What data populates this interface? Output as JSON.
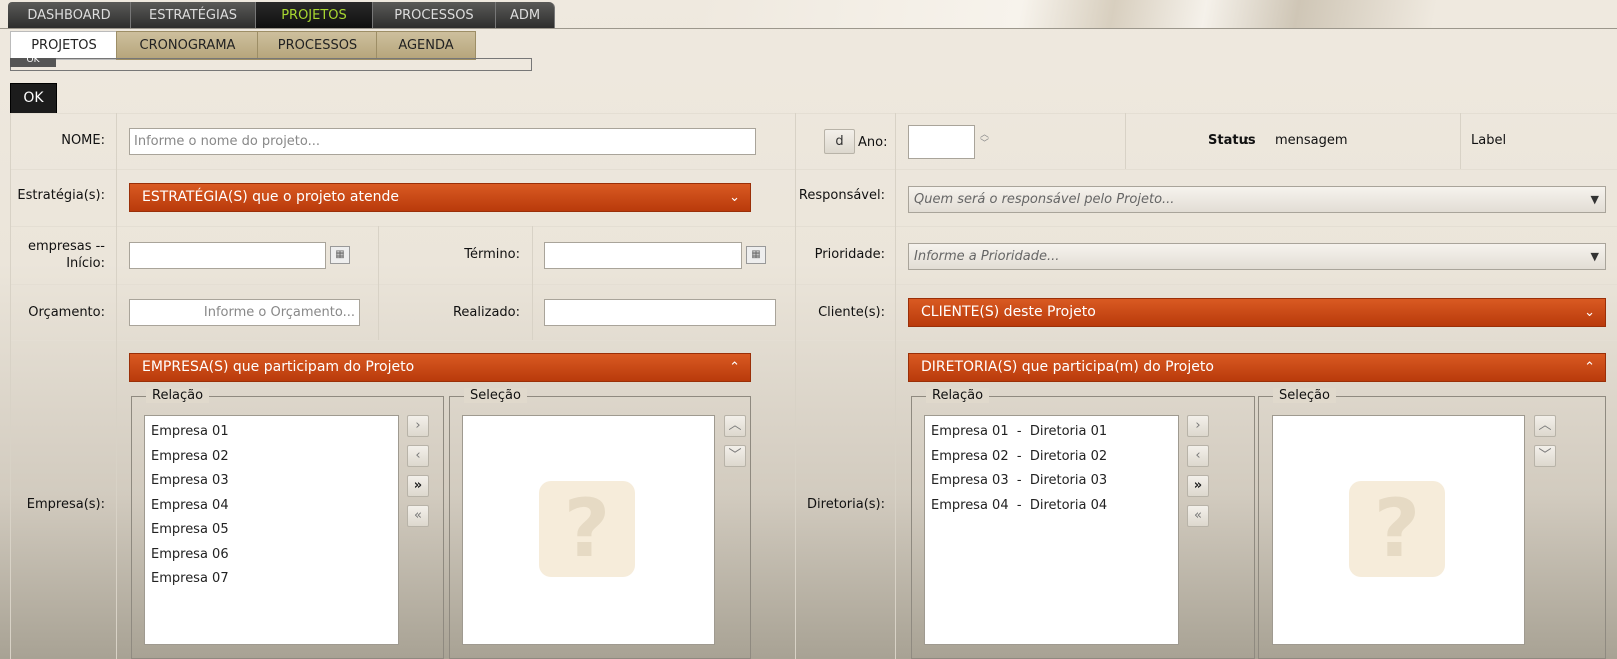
{
  "top_tabs": [
    {
      "label": "DASHBOARD"
    },
    {
      "label": "ESTRATÉGIAS"
    },
    {
      "label": "PROJETOS",
      "active": true
    },
    {
      "label": "PROCESSOS"
    },
    {
      "label": "ADM"
    }
  ],
  "sub_tabs": [
    {
      "label": "PROJETOS",
      "active": true
    },
    {
      "label": "CRONOGRAMA"
    },
    {
      "label": "PROCESSOS"
    },
    {
      "label": "AGENDA"
    }
  ],
  "ok_mini": "OK",
  "ok_button": "OK",
  "form": {
    "nome_label": "NOME:",
    "nome_placeholder": "Informe o nome do projeto...",
    "d_button": "d",
    "ano_label": "Ano:",
    "ano_value": "",
    "status_label": "Status",
    "status_colon": ":",
    "mensagem": "mensagem",
    "label_text": "Label",
    "estrategia_label": "Estratégia(s):",
    "estrategia_dropdown": "ESTRATÉGIA(S) que o projeto atende",
    "responsavel_label": "Responsável:",
    "responsavel_placeholder": "Quem será o responsável pelo Projeto...",
    "inicio_label_1": "empresas  --",
    "inicio_label_2": "Início:",
    "termino_label": "Término:",
    "prioridade_label": "Prioridade:",
    "prioridade_placeholder": "Informe a Prioridade...",
    "orcamento_label": "Orçamento:",
    "orcamento_placeholder": "Informe o Orçamento...",
    "realizado_label": "Realizado:",
    "cliente_label": "Cliente(s):",
    "cliente_dropdown": "CLIENTE(S) deste Projeto",
    "empresas_label": "Empresa(s):",
    "empresas_header": "EMPRESA(S) que participam do Projeto",
    "diretorias_label": "Diretoria(s):",
    "diretorias_header": "DIRETORIA(S) que participa(m) do Projeto",
    "relacao": "Relação",
    "selecao": "Seleção"
  },
  "empresas_list": [
    "Empresa 01",
    "Empresa 02",
    "Empresa 03",
    "Empresa 04",
    "Empresa 05",
    "Empresa 06",
    "Empresa 07"
  ],
  "diretorias_list": [
    "Empresa 01  -  Diretoria 01",
    "Empresa 02  -  Diretoria 02",
    "Empresa 03  -  Diretoria 03",
    "Empresa 04  -  Diretoria 04"
  ],
  "icons": {
    "move_right": "chevron-right-icon",
    "move_left": "chevron-left-icon",
    "move_all_right": "double-chevron-right-icon",
    "move_all_left": "double-chevron-left-icon",
    "up": "chevron-up-icon",
    "down": "chevron-down-icon",
    "calendar": "calendar-icon",
    "help": "question-mark-icon"
  },
  "colors": {
    "accent_orange": "#c94a14",
    "active_tab_text": "#a8d830",
    "tab_dark": "#2c2c2b"
  }
}
